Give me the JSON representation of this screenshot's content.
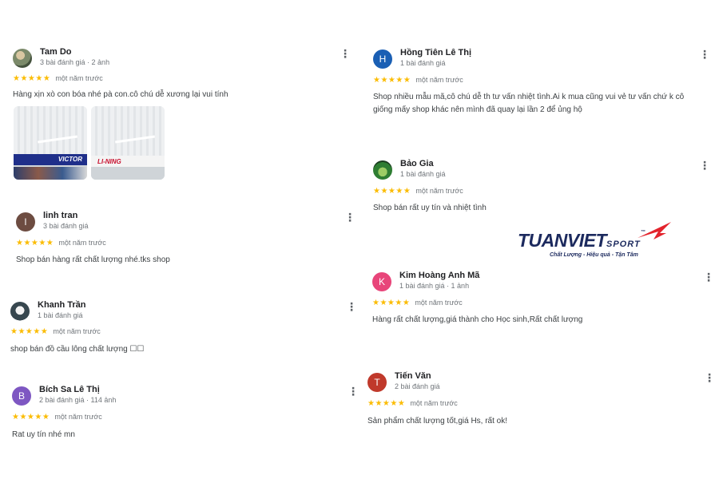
{
  "reviews": [
    {
      "name": "Tam Do",
      "meta": "3 bài đánh giá · 2 ảnh",
      "time": "một năm trước",
      "text": "Hàng xịn xò con bóa nhé pà con.cô chú dễ xương lại vui tính",
      "avatar_letter": "",
      "avatar_color": "#7b8a6a",
      "photos": [
        {
          "label": "VICTOR"
        },
        {
          "label": "LI-NING"
        }
      ]
    },
    {
      "name": "Hồng Tiên Lê Thị",
      "meta": "1 bài đánh giá",
      "time": "một năm trước",
      "text": "Shop nhiều mẫu mã,cô chú dễ th tư vấn nhiệt tình.Ai k mua cũng vui vẻ tư vấn chứ k cô giống mấy shop khác nên mình đã quay lại lần 2 để ủng hộ",
      "avatar_letter": "H",
      "avatar_color": "#1a5fb4"
    },
    {
      "name": "linh tran",
      "meta": "3 bài đánh giá",
      "time": "một năm trước",
      "text": "Shop bán hàng rất chất lượng nhé.tks shop",
      "avatar_letter": "l",
      "avatar_color": "#6d4c41"
    },
    {
      "name": "Bảo Gia",
      "meta": "1 bài đánh giá",
      "time": "một năm trước",
      "text": "Shop bán rất uy tín và nhiệt tình",
      "avatar_letter": "",
      "avatar_color": "#2e7d32"
    },
    {
      "name": "Kim Hoàng Anh Mã",
      "meta": "1 bài đánh giá · 1 ảnh",
      "time": "một năm trước",
      "text": "Hàng rất chất lượng,giá thành cho Học sinh,Rất chất lượng",
      "avatar_letter": "K",
      "avatar_color": "#e8457a"
    },
    {
      "name": "Khanh Trần",
      "meta": "1 bài đánh giá",
      "time": "một năm trước",
      "text": "shop bán đồ cầu lông chất lượng ☐☐",
      "avatar_letter": "",
      "avatar_color": "#37474f"
    },
    {
      "name": "Tiến Văn",
      "meta": "2 bài đánh giá",
      "time": "một năm trước",
      "text": "Sản phẩm chất lượng tốt,giá Hs, rất ok!",
      "avatar_letter": "T",
      "avatar_color": "#c0392b"
    },
    {
      "name": "Bích Sa Lê Thị",
      "meta": "2 bài đánh giá · 114 ảnh",
      "time": "một năm trước",
      "text": "Rat uy tín nhé mn",
      "avatar_letter": "B",
      "avatar_color": "#7e57c2"
    }
  ],
  "stars": "★★★★★",
  "more_icon": "⋮",
  "logo": {
    "main": "TUANVIET",
    "sport": "SPORT",
    "tm": "™",
    "tagline": "Chất Lượng - Hiệu quả - Tận Tâm",
    "accent": "#e3232c",
    "brand": "#1c2a5e"
  }
}
